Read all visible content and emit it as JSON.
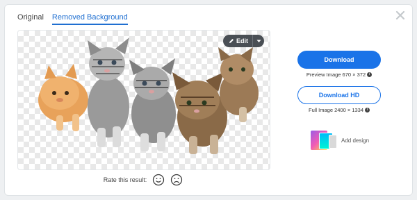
{
  "tabs": [
    {
      "label": "Original",
      "active": false
    },
    {
      "label": "Removed Background",
      "active": true
    }
  ],
  "preview": {
    "edit_label": "Edit",
    "image_alt": "five kittens with background removed"
  },
  "rating": {
    "label": "Rate this result:"
  },
  "download": {
    "primary_label": "Download",
    "preview_meta": "Preview Image 670 × 372",
    "hd_label": "Download HD",
    "hd_meta": "Full Image 2400 × 1334"
  },
  "add_design": {
    "label": "Add design"
  },
  "colors": {
    "accent": "#1a73e8",
    "tab_active": "#1f6fd1"
  },
  "icons": [
    "close-icon",
    "pencil-icon",
    "chevron-down-icon",
    "smile-icon",
    "frown-icon",
    "info-icon"
  ]
}
